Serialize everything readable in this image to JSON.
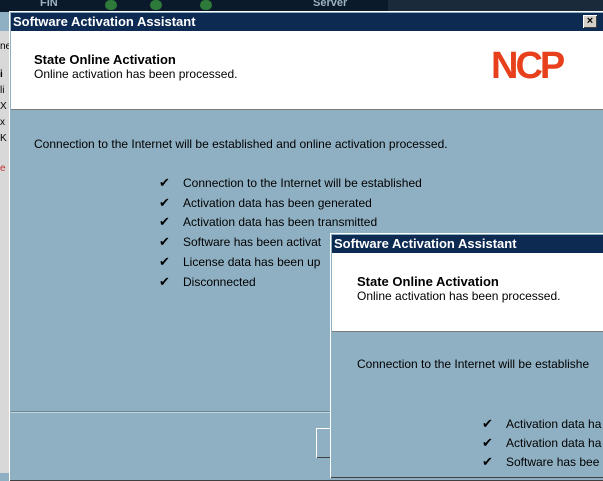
{
  "background": {
    "app_label_left": "FIN",
    "app_label_right": "Server",
    "left_fragments": [
      "ne",
      "i",
      "li",
      "X",
      "x",
      "K",
      "e"
    ]
  },
  "dialog_main": {
    "title": "Software Activation Assistant",
    "close_glyph": "×",
    "header_title": "State Online Activation",
    "header_subtitle": "Online activation has been processed.",
    "logo_text": "NCP",
    "logo_color": "#e8401c",
    "message": "Connection to the Internet will be established and online activation processed.",
    "steps": [
      "Connection to the Internet will be established",
      "Activation data has been generated",
      "Activation data has been transmitted",
      "Software has been activat",
      "License data has been up",
      "Disconnected"
    ]
  },
  "dialog_front": {
    "title": "Software Activation Assistant",
    "header_title": "State Online Activation",
    "header_subtitle": "Online activation has been processed.",
    "message": "Connection to the Internet will be establishe",
    "steps": [
      "Activation data ha",
      "Activation data ha",
      "Software has bee"
    ]
  },
  "check_glyph": "✔",
  "colors": {
    "titlebar": "#0d2a52",
    "dialog_bg": "#8fb0c2"
  }
}
